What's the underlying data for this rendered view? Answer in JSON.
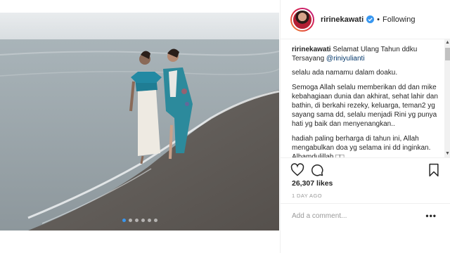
{
  "post": {
    "carousel": {
      "count": 6,
      "active_index": 0
    }
  },
  "header": {
    "username": "ririnekawati",
    "separator": "•",
    "follow_label": "Following"
  },
  "caption": {
    "username": "ririnekawati",
    "line1_text": " Selamat Ulang Tahun ddku Tersayang ",
    "mention": "@riniyulianti",
    "paragraphs": [
      "selalu ada namamu dalam doaku.",
      "Semoga Allah selalu memberikan dd dan mike kebahagiaan dunia dan akhirat, sehat lahir dan bathin, di berkahi rezeky, keluarga, teman2 yg sayang sama dd, selalu menjadi Rini yg punya hati yg baik dan menyenangkan..",
      "hadiah paling berharga di tahun ini, Allah mengabulkan doa yg selama ini dd inginkan. Alhamdulillah □□"
    ]
  },
  "actions": {
    "likes": "26,307 likes",
    "time_ago": "1 DAY AGO"
  },
  "comment": {
    "placeholder": "Add a comment...",
    "more_label": "•••"
  },
  "colors": {
    "accent_blue": "#3897f0",
    "mention_blue": "#003569",
    "muted_text": "#999999",
    "border": "#efefef"
  }
}
